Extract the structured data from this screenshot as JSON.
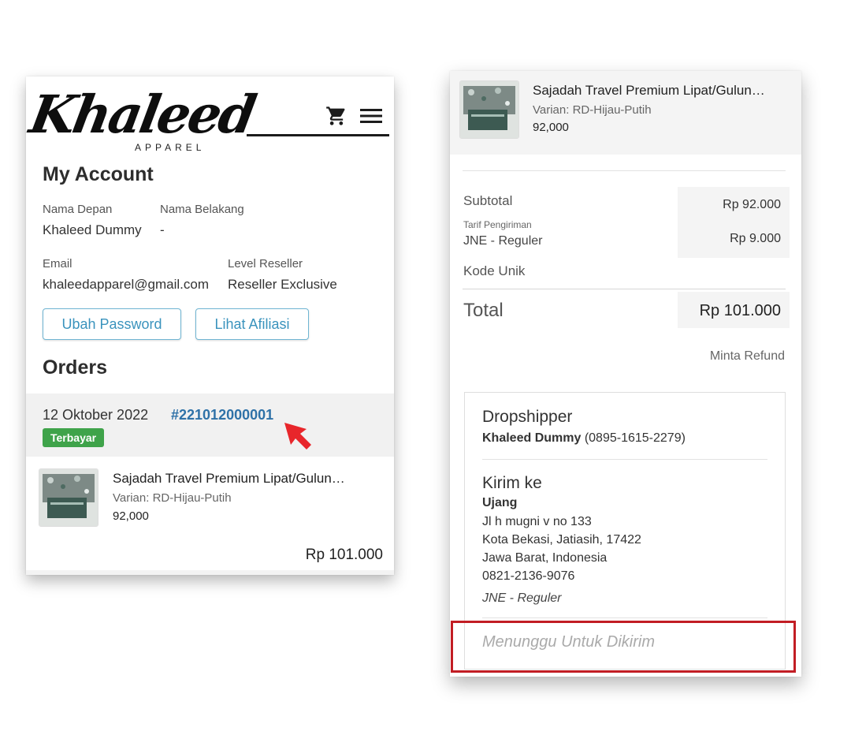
{
  "left": {
    "logo": {
      "script": "Khaleed",
      "sub": "APPAREL"
    },
    "header": {
      "cart_icon": "cart-icon",
      "menu_icon": "hamburger-menu-icon"
    },
    "account": {
      "title": "My Account",
      "first_name_label": "Nama Depan",
      "first_name_value": "Khaleed Dummy",
      "last_name_label": "Nama Belakang",
      "last_name_value": "-",
      "email_label": "Email",
      "email_value": "khaleedapparel@gmail.com",
      "level_label": "Level Reseller",
      "level_value": "Reseller Exclusive",
      "change_password_button": "Ubah Password",
      "affiliate_button": "Lihat Afiliasi"
    },
    "orders": {
      "title": "Orders",
      "date": "12 Oktober 2022",
      "order_number": "#221012000001",
      "status_badge": "Terbayar",
      "item": {
        "name": "Sajadah Travel Premium Lipat/Gulun…",
        "variant": "Varian: RD-Hijau-Putih",
        "price": "92,000"
      },
      "total": "Rp 101.000"
    }
  },
  "right": {
    "item": {
      "name": "Sajadah Travel Premium Lipat/Gulun…",
      "variant": "Varian: RD-Hijau-Putih",
      "price": "92,000"
    },
    "summary": {
      "subtotal_label": "Subtotal",
      "subtotal_value": "Rp 92.000",
      "shipping_rate_label": "Tarif Pengiriman",
      "shipping_service": "JNE - Reguler",
      "shipping_value": "Rp 9.000",
      "unique_code_label": "Kode Unik",
      "total_label": "Total",
      "total_value": "Rp 101.000",
      "refund_link": "Minta Refund"
    },
    "shipping": {
      "dropshipper_heading": "Dropshipper",
      "dropshipper_name": "Khaleed Dummy",
      "dropshipper_phone": "(0895-1615-2279)",
      "ship_to_heading": "Kirim ke",
      "recipient_name": "Ujang",
      "address_line1": "Jl h mugni v no 133",
      "address_line2": "Kota Bekasi, Jatiasih, 17422",
      "address_line3": "Jawa Barat, Indonesia",
      "phone": "0821-2136-9076",
      "courier": "JNE - Reguler",
      "status": "Menunggu Untuk Dikirim"
    }
  },
  "colors": {
    "link_blue": "#2f72a8",
    "button_border": "#6fb5d3",
    "badge_green": "#3fa34a",
    "highlight_red": "#c21d24"
  }
}
